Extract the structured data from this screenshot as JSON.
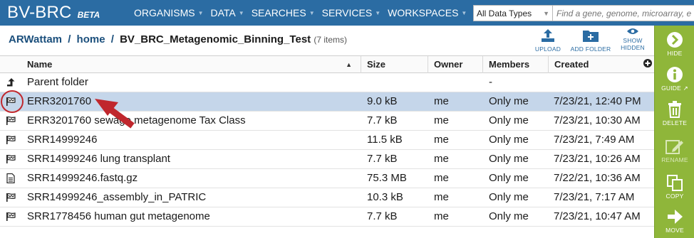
{
  "brand": {
    "name": "BV-BRC",
    "tag": "BETA"
  },
  "nav": [
    {
      "label": "ORGANISMS"
    },
    {
      "label": "DATA"
    },
    {
      "label": "SEARCHES"
    },
    {
      "label": "SERVICES"
    },
    {
      "label": "WORKSPACES"
    }
  ],
  "search": {
    "type_selected": "All Data Types",
    "placeholder": "Find a gene, genome, microarray, et"
  },
  "breadcrumb": {
    "user": "ARWattam",
    "sep1": "/",
    "home": "home",
    "sep2": "/",
    "folder": "BV_BRC_Metagenomic_Binning_Test",
    "count": "(7 items)"
  },
  "header_actions": [
    {
      "label": "UPLOAD",
      "icon": "upload-icon"
    },
    {
      "label": "ADD FOLDER",
      "icon": "add-folder-icon"
    },
    {
      "label": "SHOW HIDDEN",
      "icon": "eye-icon"
    }
  ],
  "table": {
    "columns": [
      "Name",
      "Size",
      "Owner",
      "Members",
      "Created"
    ],
    "sort_indicator": "▲",
    "column_menu_icon": "plus-circle-icon",
    "rows": [
      {
        "icon": "up-arrow-icon",
        "name": "Parent folder",
        "size": "",
        "owner": "",
        "members": "-",
        "created": ""
      },
      {
        "icon": "job-flag-icon",
        "name": "ERR3201760",
        "size": "9.0 kB",
        "owner": "me",
        "members": "Only me",
        "created": "7/23/21, 12:40 PM",
        "selected": true
      },
      {
        "icon": "job-flag-icon",
        "name": "ERR3201760 sewage metagenome Tax Class",
        "size": "7.7 kB",
        "owner": "me",
        "members": "Only me",
        "created": "7/23/21, 10:30 AM"
      },
      {
        "icon": "job-flag-icon",
        "name": "SRR14999246",
        "size": "11.5 kB",
        "owner": "me",
        "members": "Only me",
        "created": "7/23/21, 7:49 AM"
      },
      {
        "icon": "job-flag-icon",
        "name": "SRR14999246 lung transplant",
        "size": "7.7 kB",
        "owner": "me",
        "members": "Only me",
        "created": "7/23/21, 10:26 AM"
      },
      {
        "icon": "file-icon",
        "name": "SRR14999246.fastq.gz",
        "size": "75.3 MB",
        "owner": "me",
        "members": "Only me",
        "created": "7/22/21, 10:36 AM"
      },
      {
        "icon": "job-flag-icon",
        "name": "SRR14999246_assembly_in_PATRIC",
        "size": "10.3 kB",
        "owner": "me",
        "members": "Only me",
        "created": "7/23/21, 7:17 AM"
      },
      {
        "icon": "job-flag-icon",
        "name": "SRR1778456 human gut metagenome",
        "size": "7.7 kB",
        "owner": "me",
        "members": "Only me",
        "created": "7/23/21, 10:47 AM"
      }
    ]
  },
  "side_panel": [
    {
      "label": "HIDE",
      "icon": "chevron-right-circle-icon"
    },
    {
      "label": "GUIDE",
      "icon": "info-circle-icon"
    },
    {
      "label": "DELETE",
      "icon": "trash-icon"
    },
    {
      "label": "RENAME",
      "icon": "edit-icon",
      "disabled": true
    },
    {
      "label": "COPY",
      "icon": "copy-icon"
    },
    {
      "label": "MOVE",
      "icon": "arrow-right-icon"
    }
  ],
  "annotation_colors": {
    "highlight": "#c0272d",
    "selection": "#c5d6ea",
    "nav": "#2b6ca3",
    "panel": "#8fb63a"
  }
}
